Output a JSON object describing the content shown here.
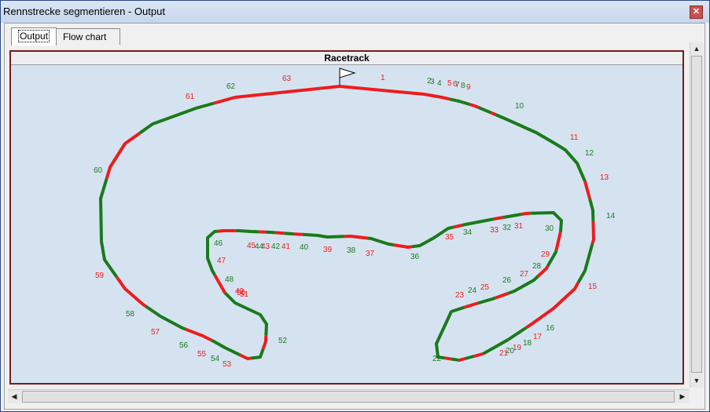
{
  "window": {
    "title": "Rennstrecke segmentieren - Output",
    "close_label": "✕"
  },
  "tabs": [
    {
      "label": "Output",
      "active": true
    },
    {
      "label": "Flow chart",
      "active": false
    }
  ],
  "panel": {
    "title": "Racetrack"
  },
  "colors": {
    "green": "#1a7a1a",
    "red": "#ee1c1c"
  },
  "track": {
    "segments": [
      {
        "label": "1",
        "color": "red"
      },
      {
        "label": "2",
        "color": "green"
      },
      {
        "label": "3",
        "color": "green"
      },
      {
        "label": "4",
        "color": "green"
      },
      {
        "label": "5",
        "color": "red"
      },
      {
        "label": "6",
        "color": "red"
      },
      {
        "label": "7",
        "color": "green"
      },
      {
        "label": "8",
        "color": "green"
      },
      {
        "label": "9",
        "color": "red"
      },
      {
        "label": "10",
        "color": "green"
      },
      {
        "label": "11",
        "color": "red"
      },
      {
        "label": "12",
        "color": "green"
      },
      {
        "label": "13",
        "color": "red"
      },
      {
        "label": "14",
        "color": "green"
      },
      {
        "label": "15",
        "color": "red"
      },
      {
        "label": "16",
        "color": "green"
      },
      {
        "label": "17",
        "color": "red"
      },
      {
        "label": "18",
        "color": "green"
      },
      {
        "label": "19",
        "color": "red"
      },
      {
        "label": "20",
        "color": "green"
      },
      {
        "label": "21",
        "color": "red"
      },
      {
        "label": "22",
        "color": "green"
      },
      {
        "label": "23",
        "color": "red"
      },
      {
        "label": "24",
        "color": "green"
      },
      {
        "label": "25",
        "color": "red"
      },
      {
        "label": "26",
        "color": "green"
      },
      {
        "label": "27",
        "color": "red"
      },
      {
        "label": "28",
        "color": "green"
      },
      {
        "label": "29",
        "color": "red"
      },
      {
        "label": "30",
        "color": "green"
      },
      {
        "label": "31",
        "color": "red"
      },
      {
        "label": "32",
        "color": "green"
      },
      {
        "label": "33",
        "color": "red"
      },
      {
        "label": "34",
        "color": "green"
      },
      {
        "label": "35",
        "color": "red"
      },
      {
        "label": "36",
        "color": "green"
      },
      {
        "label": "37",
        "color": "red"
      },
      {
        "label": "38",
        "color": "green"
      },
      {
        "label": "39",
        "color": "red"
      },
      {
        "label": "40",
        "color": "green"
      },
      {
        "label": "41",
        "color": "red"
      },
      {
        "label": "42",
        "color": "green"
      },
      {
        "label": "43",
        "color": "red"
      },
      {
        "label": "44",
        "color": "green"
      },
      {
        "label": "45",
        "color": "red"
      },
      {
        "label": "46",
        "color": "green"
      },
      {
        "label": "47",
        "color": "red"
      },
      {
        "label": "48",
        "color": "green"
      },
      {
        "label": "49",
        "color": "red"
      },
      {
        "label": "50",
        "color": "red"
      },
      {
        "label": "51",
        "color": "red"
      },
      {
        "label": "52",
        "color": "green"
      },
      {
        "label": "53",
        "color": "red"
      },
      {
        "label": "54",
        "color": "green"
      },
      {
        "label": "55",
        "color": "red"
      },
      {
        "label": "56",
        "color": "green"
      },
      {
        "label": "57",
        "color": "red"
      },
      {
        "label": "58",
        "color": "green"
      },
      {
        "label": "59",
        "color": "red"
      },
      {
        "label": "60",
        "color": "green"
      },
      {
        "label": "61",
        "color": "red"
      },
      {
        "label": "62",
        "color": "green"
      },
      {
        "label": "63",
        "color": "red"
      }
    ]
  }
}
